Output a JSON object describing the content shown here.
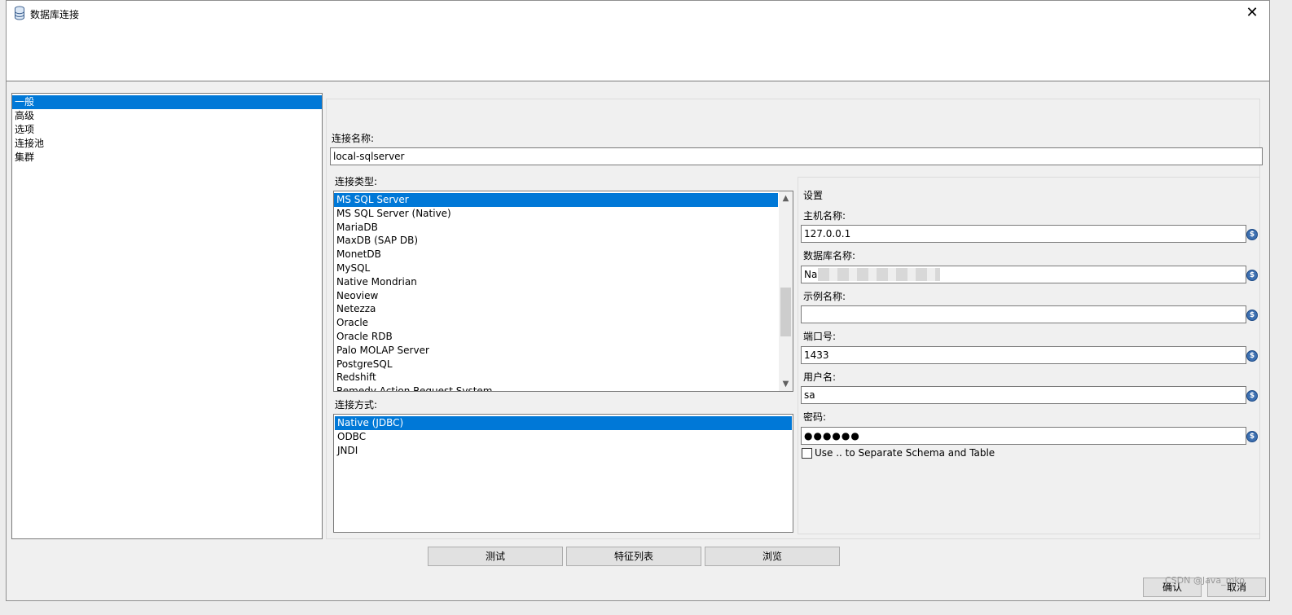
{
  "window": {
    "title": "数据库连接",
    "close_symbol": "✕"
  },
  "nav": {
    "items": [
      "一般",
      "高级",
      "选项",
      "连接池",
      "集群"
    ],
    "selected": 0
  },
  "connection_name": {
    "label": "连接名称:",
    "value": "local-sqlserver"
  },
  "connection_type": {
    "label": "连接类型:",
    "items": [
      "MS SQL Server",
      "MS SQL Server (Native)",
      "MariaDB",
      "MaxDB (SAP DB)",
      "MonetDB",
      "MySQL",
      "Native Mondrian",
      "Neoview",
      "Netezza",
      "Oracle",
      "Oracle RDB",
      "Palo MOLAP Server",
      "PostgreSQL",
      "Redshift",
      "Remedy Action Request System"
    ],
    "selected": 0
  },
  "access_method": {
    "label": "连接方式:",
    "items": [
      "Native (JDBC)",
      "ODBC",
      "JNDI"
    ],
    "selected": 0
  },
  "settings": {
    "title": "设置",
    "host": {
      "label": "主机名称:",
      "value": "127.0.0.1"
    },
    "database": {
      "label": "数据库名称:",
      "value": "Na"
    },
    "instance": {
      "label": "示例名称:",
      "value": ""
    },
    "port": {
      "label": "端口号:",
      "value": "1433"
    },
    "username": {
      "label": "用户名:",
      "value": "sa"
    },
    "password": {
      "label": "密码:",
      "value": "●●●●●●"
    },
    "separator_checkbox": {
      "label": "Use .. to Separate Schema and Table",
      "checked": false
    },
    "variable_icon": "$"
  },
  "buttons": {
    "test": "测试",
    "features": "特征列表",
    "explore": "浏览",
    "ok": "确认",
    "cancel": "取消"
  },
  "watermark": "CSDN @Java_mko",
  "icons": {
    "title": "database-icon",
    "close": "close-icon",
    "variable": "variable-icon",
    "scroll_up": "scroll-up-icon",
    "scroll_down": "scroll-down-icon"
  },
  "colors": {
    "selection": "#0078d7",
    "variable_icon": "#3c6fb0"
  }
}
